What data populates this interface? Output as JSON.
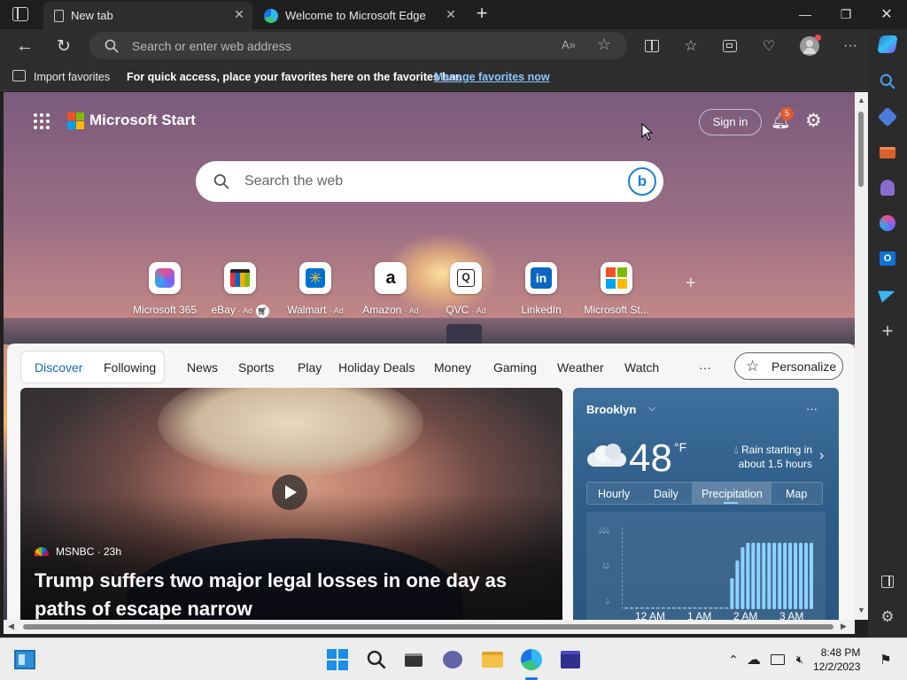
{
  "tabs": [
    {
      "label": "New tab",
      "active": true
    },
    {
      "label": "Welcome to Microsoft Edge",
      "active": false
    }
  ],
  "address": {
    "placeholder": "Search or enter web address"
  },
  "favorites_bar": {
    "import_label": "Import favorites",
    "hint": "For quick access, place your favorites here on the favorites bar.",
    "manage_link": "Manage favorites now"
  },
  "start": {
    "brand": "Microsoft Start",
    "sign_in": "Sign in",
    "notification_count": "5",
    "search_placeholder": "Search the web"
  },
  "quick_links": [
    {
      "label": "Microsoft 365",
      "ad": ""
    },
    {
      "label": "eBay",
      "ad": "· Ad"
    },
    {
      "label": "Walmart",
      "ad": "· Ad"
    },
    {
      "label": "Amazon",
      "ad": "· Ad"
    },
    {
      "label": "QVC",
      "ad": "· Ad"
    },
    {
      "label": "LinkedIn",
      "ad": ""
    },
    {
      "label": "Microsoft St...",
      "ad": ""
    }
  ],
  "pivots": {
    "discover": "Discover",
    "following": "Following",
    "items": [
      "News",
      "Sports",
      "Play",
      "Holiday Deals",
      "Money",
      "Gaming",
      "Weather",
      "Watch"
    ],
    "more": "···",
    "personalize": "Personalize"
  },
  "news": {
    "source": "MSNBC · 23h",
    "headline": "Trump suffers two major legal losses in one day as paths of escape narrow"
  },
  "weather": {
    "city": "Brooklyn",
    "temp": "48",
    "unit": "°F",
    "desc": "Rain starting in about 1.5 hours",
    "tabs": [
      "Hourly",
      "Daily",
      "Precipitation",
      "Map"
    ],
    "selected_tab": "Precipitation",
    "precip_labels": [
      "12 AM",
      "1 AM",
      "2 AM",
      "3 AM"
    ],
    "precip_intensity": [
      0,
      0,
      0,
      0,
      0,
      0,
      0,
      0,
      0,
      0,
      0,
      0,
      0,
      0,
      0,
      0,
      0,
      0,
      0,
      0,
      0.35,
      0.55,
      0.7,
      0.75,
      0.75,
      0.75,
      0.75,
      0.75,
      0.75,
      0.75,
      0.75,
      0.75,
      0.75,
      0.75,
      0.75,
      0.75
    ]
  },
  "taskbar": {
    "time": "8:48 PM",
    "date": "12/2/2023"
  },
  "colors": {
    "accent": "#0f6cbd",
    "link": "#8ec6ff",
    "badge": "#e05a2c",
    "precip_bar": "#8fd3ff"
  }
}
